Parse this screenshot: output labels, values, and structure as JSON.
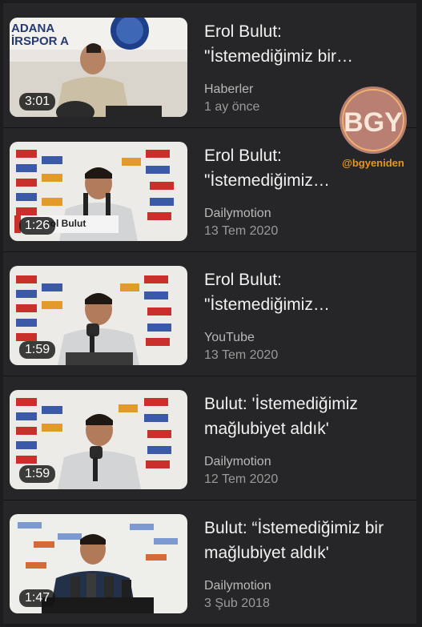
{
  "results": [
    {
      "title": "Erol Bulut:\n\"İstemediğimiz bir…",
      "source": "Haberler",
      "date": "1 ay önce",
      "duration": "3:01",
      "overlay_text": "ADANA\nİRSPOR A",
      "lower_third": ""
    },
    {
      "title": "Erol Bulut:\n\"İstemediğimiz…",
      "source": "Dailymotion",
      "date": "13 Tem 2020",
      "duration": "1:26",
      "overlay_text": "",
      "lower_third": "rol Bulut"
    },
    {
      "title": "Erol Bulut:\n\"İstemediğimiz…",
      "source": "YouTube",
      "date": "13 Tem 2020",
      "duration": "1:59",
      "overlay_text": "",
      "lower_third": ""
    },
    {
      "title": "Bulut: 'İstemediğimiz\nmağlubiyet aldık'",
      "source": "Dailymotion",
      "date": "12 Tem 2020",
      "duration": "1:59",
      "overlay_text": "",
      "lower_third": ""
    },
    {
      "title": "Bulut: “İstemediğimiz bir\nmağlubiyet aldık'",
      "source": "Dailymotion",
      "date": "3 Şub 2018",
      "duration": "1:47",
      "overlay_text": "",
      "lower_third": ""
    }
  ],
  "watermark": {
    "logo_text": "BGY",
    "handle": "@bgyeniden"
  },
  "colors": {
    "background": "#262628",
    "title": "#f2f2f2",
    "meta": "#b9b9b9",
    "watermark": "#e8961c"
  }
}
